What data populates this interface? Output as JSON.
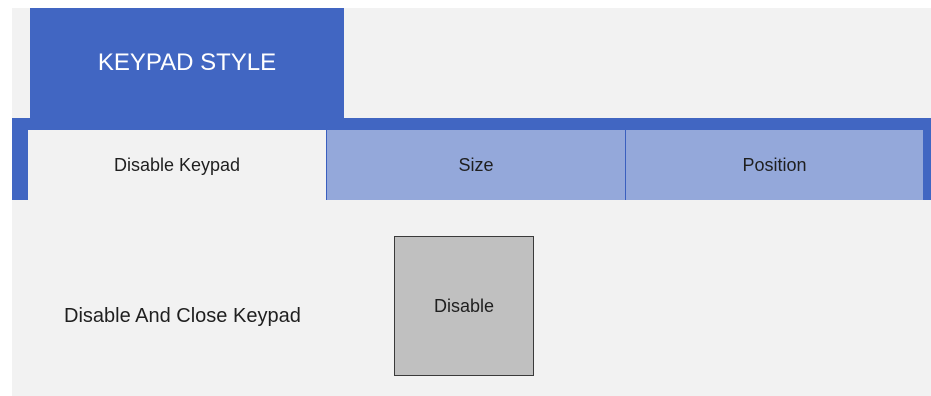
{
  "header": {
    "title": "KEYPAD STYLE"
  },
  "tabs": [
    {
      "label": "Disable Keypad",
      "active": true
    },
    {
      "label": "Size",
      "active": false
    },
    {
      "label": "Position",
      "active": false
    }
  ],
  "content": {
    "label": "Disable And Close Keypad",
    "button_label": "Disable"
  },
  "colors": {
    "accent": "#4166c2",
    "inactive_tab": "#94a8da",
    "panel_background": "#f2f2f2",
    "button_background": "#c0c0c0"
  }
}
